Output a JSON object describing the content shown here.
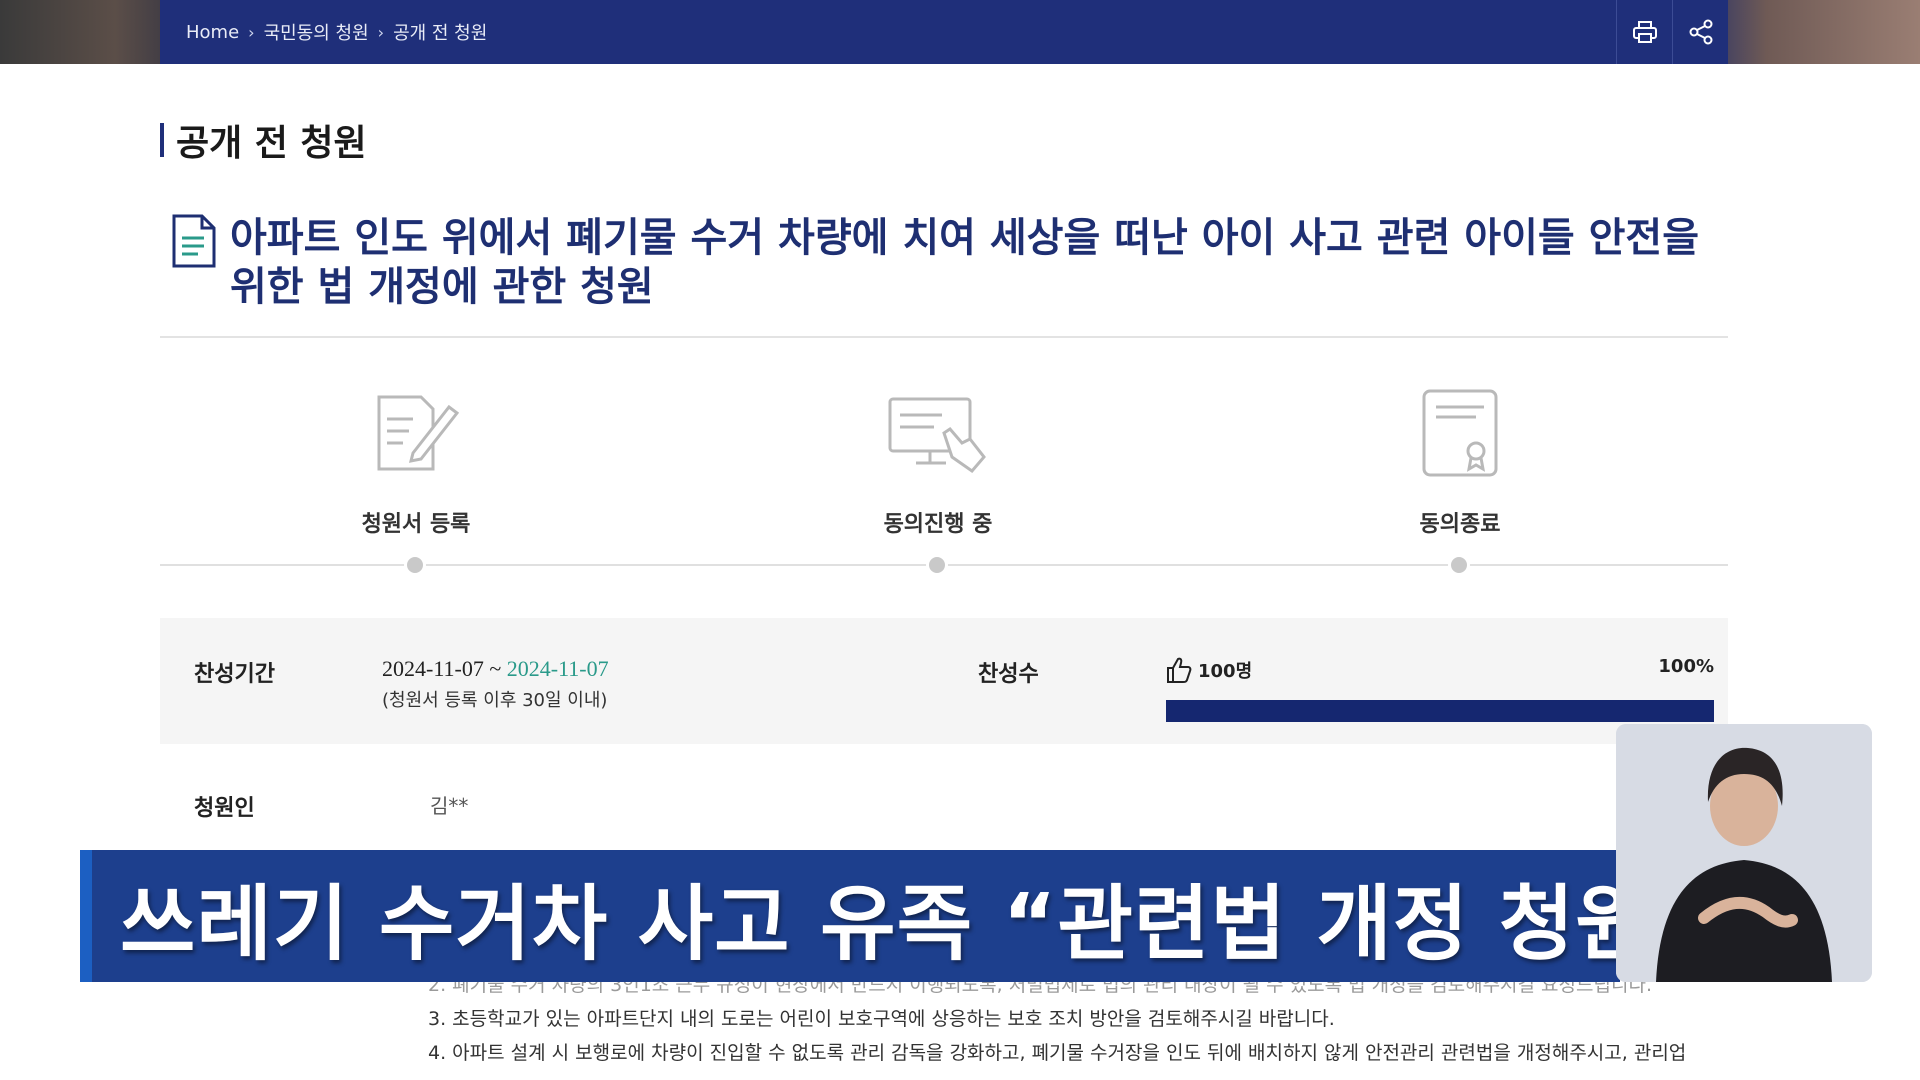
{
  "breadcrumb": {
    "home": "Home",
    "level1": "국민동의 청원",
    "level2": "공개 전 청원"
  },
  "toolbar": {
    "print_icon": "printer-icon",
    "share_icon": "share-icon"
  },
  "page": {
    "title": "공개 전 청원"
  },
  "petition": {
    "title": "아파트 인도 위에서 폐기물 수거 차량에 치여 세상을 떠난 아이 사고 관련 아이들 안전을 위한 법 개정에 관한 청원"
  },
  "steps": [
    {
      "label": "청원서 등록",
      "icon": "document-pen-icon"
    },
    {
      "label": "동의진행 중",
      "icon": "monitor-hand-icon"
    },
    {
      "label": "동의종료",
      "icon": "certificate-icon"
    }
  ],
  "info": {
    "period_label": "찬성기간",
    "period_start": "2024-11-07 ~ ",
    "period_end": "2024-11-07",
    "period_note": "(청원서 등록 이후 30일 이내)",
    "count_label": "찬성수",
    "count_value": "100명",
    "count_percent": "100%",
    "progress_fraction": 1.0
  },
  "petitioner": {
    "label": "청원인",
    "name": "김**"
  },
  "body": {
    "line2": "2. 폐기물 수거 차량의 3인1조 근무 규정이 현장에서 반드시 이행되도록, 처벌법제로 법의 관리 대상이 될 수 있도록 법 개정을 검토해주시길 요청드립니다.",
    "line3": "3. 초등학교가 있는 아파트단지 내의 도로는 어린이 보호구역에 상응하는 보호 조치 방안을 검토해주시길 바랍니다.",
    "line4": "4. 아파트 설계 시 보행로에 차량이 진입할 수 없도록 관리 감독을 강화하고, 폐기물 수거장을 인도 뒤에 배치하지 않게 안전관리 관련법을 개정해주시고, 관리업"
  },
  "caption": {
    "text": "쓰레기 수거차 사고 유족 “관련법 개정 청원”"
  },
  "colors": {
    "navy": "#1f2f7a",
    "progress": "#152770",
    "accent_green": "#2a9a8a",
    "banner": "#1d3f8d"
  }
}
